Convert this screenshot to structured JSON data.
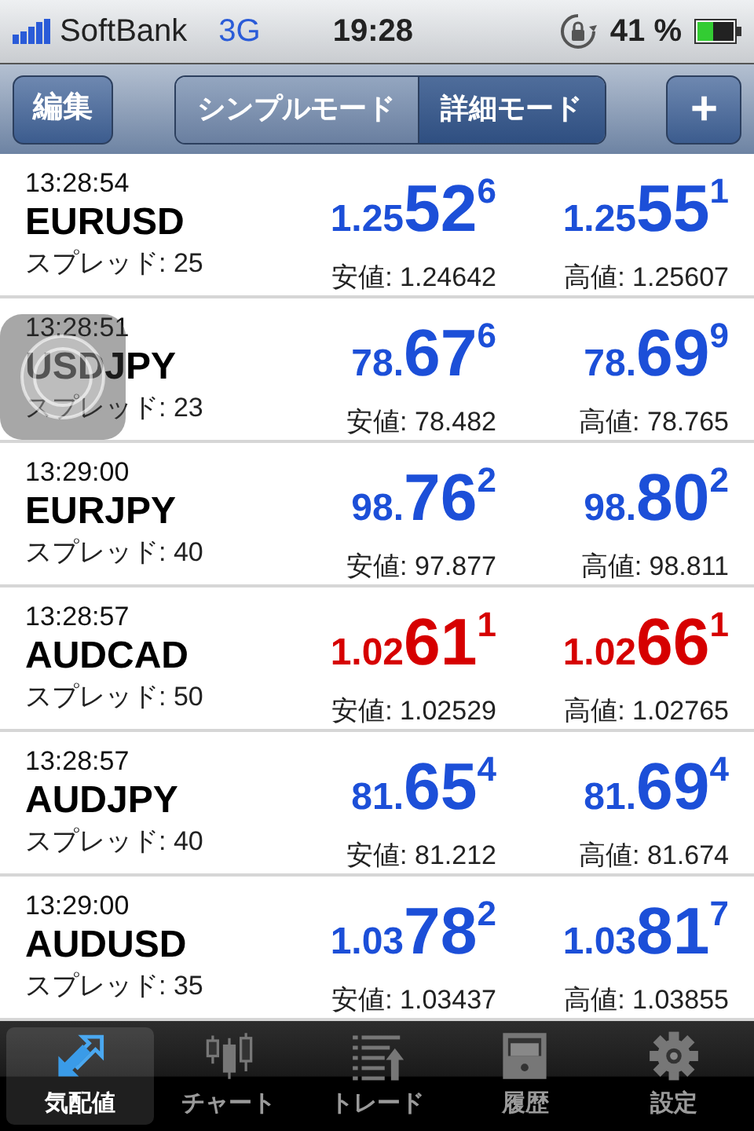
{
  "status_bar": {
    "carrier": "SoftBank",
    "network": "3G",
    "time": "19:28",
    "battery": "41 %"
  },
  "toolbar": {
    "edit": "編集",
    "segments": [
      {
        "label": "シンプルモード",
        "selected": false
      },
      {
        "label": "詳細モード",
        "selected": true
      }
    ],
    "add": "+"
  },
  "quotes": [
    {
      "time": "13:28:54",
      "symbol": "EURUSD",
      "spread": "スプレッド: 25",
      "color": "#1c4fd8",
      "bid": {
        "prefix": "1.25",
        "big": "52",
        "sup": "6",
        "extreme": "安値: 1.24642"
      },
      "ask": {
        "prefix": "1.25",
        "big": "55",
        "sup": "1",
        "extreme": "高値: 1.25607"
      }
    },
    {
      "time": "13:28:51",
      "symbol": "USDJPY",
      "spread": "スプレッド: 23",
      "color": "#1c4fd8",
      "bid": {
        "prefix": "78.",
        "big": "67",
        "sup": "6",
        "extreme": "安値: 78.482"
      },
      "ask": {
        "prefix": "78.",
        "big": "69",
        "sup": "9",
        "extreme": "高値: 78.765"
      }
    },
    {
      "time": "13:29:00",
      "symbol": "EURJPY",
      "spread": "スプレッド: 40",
      "color": "#1c4fd8",
      "bid": {
        "prefix": "98.",
        "big": "76",
        "sup": "2",
        "extreme": "安値: 97.877"
      },
      "ask": {
        "prefix": "98.",
        "big": "80",
        "sup": "2",
        "extreme": "高値: 98.811"
      }
    },
    {
      "time": "13:28:57",
      "symbol": "AUDCAD",
      "spread": "スプレッド: 50",
      "color": "#d60000",
      "bid": {
        "prefix": "1.02",
        "big": "61",
        "sup": "1",
        "extreme": "安値: 1.02529"
      },
      "ask": {
        "prefix": "1.02",
        "big": "66",
        "sup": "1",
        "extreme": "高値: 1.02765"
      }
    },
    {
      "time": "13:28:57",
      "symbol": "AUDJPY",
      "spread": "スプレッド: 40",
      "color": "#1c4fd8",
      "bid": {
        "prefix": "81.",
        "big": "65",
        "sup": "4",
        "extreme": "安値: 81.212"
      },
      "ask": {
        "prefix": "81.",
        "big": "69",
        "sup": "4",
        "extreme": "高値: 81.674"
      }
    },
    {
      "time": "13:29:00",
      "symbol": "AUDUSD",
      "spread": "スプレッド: 35",
      "color": "#1c4fd8",
      "bid": {
        "prefix": "1.03",
        "big": "78",
        "sup": "2",
        "extreme": "安値: 1.03437"
      },
      "ask": {
        "prefix": "1.03",
        "big": "81",
        "sup": "7",
        "extreme": "高値: 1.03855"
      }
    }
  ],
  "tab_bar": [
    {
      "kind": "quotes",
      "label": "気配値",
      "selected": true
    },
    {
      "kind": "chart",
      "label": "チャート",
      "selected": false
    },
    {
      "kind": "trade",
      "label": "トレード",
      "selected": false
    },
    {
      "kind": "history",
      "label": "履歴",
      "selected": false
    },
    {
      "kind": "settings",
      "label": "設定",
      "selected": false
    }
  ]
}
